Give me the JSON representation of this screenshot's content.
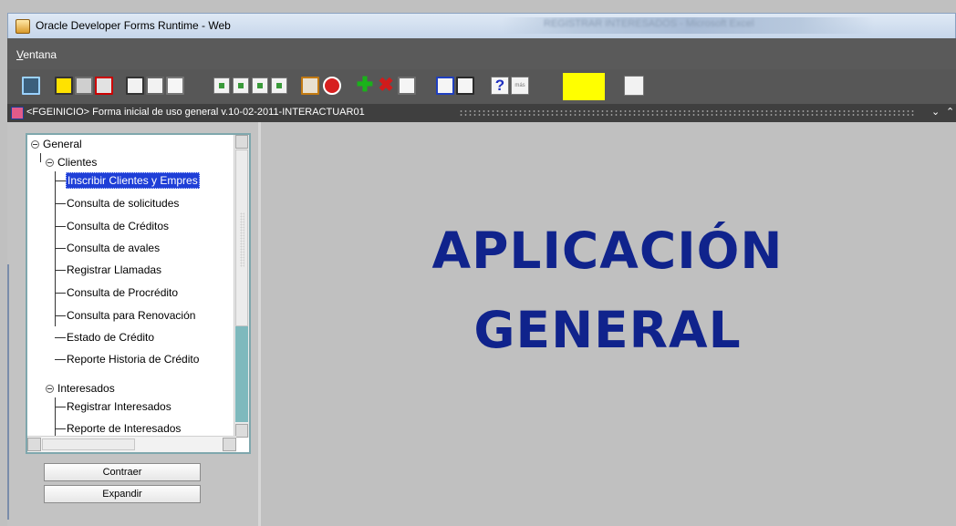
{
  "window": {
    "title": "Oracle Developer Forms Runtime - Web",
    "blurred_tab_text": "REGISTRAR INTERESADOS - Microsoft Excel"
  },
  "menu": {
    "items": [
      "Ventana"
    ]
  },
  "toolbar": {
    "buttons": [
      {
        "name": "exit-icon"
      },
      {
        "name": "save-icon"
      },
      {
        "name": "print-icon"
      },
      {
        "name": "clear-form-icon"
      },
      {
        "name": "cut-icon"
      },
      {
        "name": "copy-icon"
      },
      {
        "name": "paste-icon"
      },
      {
        "name": "first-record-icon"
      },
      {
        "name": "previous-record-icon"
      },
      {
        "name": "next-record-icon"
      },
      {
        "name": "last-record-icon"
      },
      {
        "name": "enter-query-icon"
      },
      {
        "name": "cancel-query-icon"
      },
      {
        "name": "insert-record-icon"
      },
      {
        "name": "delete-record-icon"
      },
      {
        "name": "edit-icon"
      },
      {
        "name": "list-of-values-icon"
      },
      {
        "name": "edit-field-icon"
      },
      {
        "name": "help-icon"
      },
      {
        "name": "more-icon"
      },
      {
        "name": "tools-icon"
      }
    ],
    "more_label": "más",
    "highlight_color": "#ffff00"
  },
  "form": {
    "title": "<FGEINICIO> Forma inicial de uso general v.10-02-2011-INTERACTUAR01",
    "minimize_symbol": "⌄",
    "maximize_symbol": "⌃"
  },
  "tree": {
    "nodes": [
      {
        "label": "General"
      },
      {
        "label": "Clientes"
      },
      {
        "label": "Inscribir Clientes y Empres"
      },
      {
        "label": "Consulta de solicitudes"
      },
      {
        "label": "Consulta de Créditos"
      },
      {
        "label": "Consulta de avales"
      },
      {
        "label": "Registrar Llamadas"
      },
      {
        "label": "Consulta de Procrédito"
      },
      {
        "label": "Consulta para Renovación"
      },
      {
        "label": "Estado de Crédito"
      },
      {
        "label": "Reporte Historia de Crédito"
      },
      {
        "label": "Interesados"
      },
      {
        "label": "Registrar Interesados"
      },
      {
        "label": "Reporte de Interesados"
      }
    ]
  },
  "buttons": {
    "collapse_label": "Contraer",
    "expand_label": "Expandir"
  },
  "main": {
    "title_line1": "APLICACIÓN",
    "title_line2": "GENERAL",
    "title_color": "#10238c"
  }
}
